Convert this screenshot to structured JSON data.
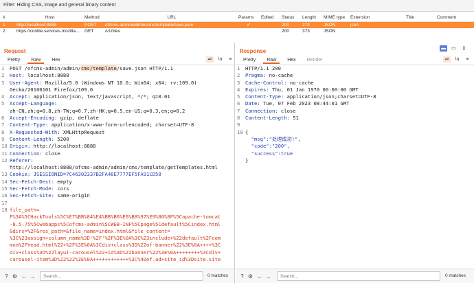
{
  "filter": {
    "text": "Filter: Hiding CSS, image and general binary content"
  },
  "table": {
    "headers": {
      "num": "#",
      "host": "Host",
      "method": "Method",
      "url": "URL",
      "params": "Params",
      "edited": "Edited",
      "status": "Status",
      "length": "Length",
      "mime": "MIME type",
      "extension": "Extension",
      "title": "Title",
      "comment": "Comment"
    },
    "rows": [
      {
        "num": "1",
        "host": "http://localhost:8888",
        "method": "POST",
        "url": "/ofcms-admin/admin/cms/template/save.json",
        "params": "✔",
        "edited": "",
        "status": "200",
        "length": "273",
        "mime": "JSON",
        "extension": "json",
        "title": "",
        "comment": ""
      },
      {
        "num": "2",
        "host": "https://contile.services.mozilla....",
        "method": "GET",
        "url": "/v1/tiles",
        "params": "",
        "edited": "",
        "status": "200",
        "length": "373",
        "mime": "JSON",
        "extension": "",
        "title": "",
        "comment": ""
      }
    ]
  },
  "request": {
    "title": "Request",
    "tabs": [
      "Pretty",
      "Raw",
      "Hex"
    ],
    "icons": {
      "wrap": "⇌",
      "newline": "\\n",
      "menu": "≡"
    },
    "lines": [
      {
        "n": "1",
        "a": "POST /ofcms-admin/admin/",
        "h": "cms/template",
        "b": "/save.json HTTP/1.1"
      },
      {
        "n": "2",
        "k": "Host:",
        "v": " localhost:8888"
      },
      {
        "n": "3",
        "k": "User-Agent:",
        "v": " Mozilla/5.0 (Windows NT 10.0; Win64; x64; rv:109.0)"
      },
      {
        "n": "",
        "v": "Gecko/20100101 Firefox/109.0"
      },
      {
        "n": "4",
        "k": "Accept:",
        "v": " application/json, text/javascript, */*; q=0.01"
      },
      {
        "n": "5",
        "k": "Accept-Language:",
        "v": ""
      },
      {
        "n": "",
        "v": "zh-CN,zh;q=0.8,zh-TW;q=0.7,zh-HK;q=0.5,en-US;q=0.3,en;q=0.2"
      },
      {
        "n": "6",
        "k": "Accept-Encoding:",
        "v": " gzip, deflate"
      },
      {
        "n": "7",
        "k": "Content-Type:",
        "v": " application/x-www-form-urlencoded; charset=UTF-8"
      },
      {
        "n": "8",
        "k": "X-Requested-With:",
        "v": " XMLHttpRequest"
      },
      {
        "n": "9",
        "k": "Content-Length:",
        "v": " 5200"
      },
      {
        "n": "10",
        "k": "Origin:",
        "v": " http://localhost:8888"
      },
      {
        "n": "11",
        "k": "Connection:",
        "v": " close"
      },
      {
        "n": "12",
        "k": "Referer:",
        "v": ""
      },
      {
        "n": "",
        "v": "http://localhost:8888/ofcms-admin/admin/cms/template/getTemplates.html"
      },
      {
        "n": "13",
        "k": "Cookie:",
        "v": " JSESSIONID=",
        "c": "7C46302337B2FA48E7777EF5FA91CD58"
      },
      {
        "n": "14",
        "k": "Sec-Fetch-Dest:",
        "v": " empty"
      },
      {
        "n": "15",
        "k": "Sec-Fetch-Mode:",
        "v": " cors"
      },
      {
        "n": "16",
        "k": "Sec-Fetch-Site:",
        "v": " same-origin"
      },
      {
        "n": "17",
        "v": ""
      },
      {
        "n": "18",
        "r": "file_path="
      },
      {
        "n": "",
        "r": "F%3A%5CHackTools%5C%E7%BB%84%E4%BB%B6%E6%B8%97%E9%80%8F%5Capache-tomcat"
      },
      {
        "n": "",
        "r": "-8.5.75%5Cwebapps%5Cofcms-admin%5CWEB-INF%5Cpage%5Cdefault%5Cindex.html"
      },
      {
        "n": "",
        "r": "&dirs=%2F&res_path=&file_name=index.html&file_content="
      },
      {
        "n": "",
        "r": "%3C%23assign+column_name%3D'%2F'%2F%3E%0A%3C%23include+%22default%2Fcom"
      },
      {
        "n": "",
        "r": "mon%2Fhead.html%22+%2F%3E%0A%3Cdiv+class%3D%22of-banner%22%3E%0A++++%3C"
      },
      {
        "n": "",
        "r": "div+class%3D%22layui-carousel%22+id%3D%22banner%22%3E%0A++++++++%3Cdiv+"
      },
      {
        "n": "",
        "r": "carousel-item%3D%22%22%3E%0A++++++++++++%3C%40of.ad+site_id%3Dsite.site"
      }
    ],
    "search_placeholder": "Search...",
    "matches": "0 matches"
  },
  "response": {
    "title": "Response",
    "tabs": [
      "Pretty",
      "Raw",
      "Hex",
      "Render"
    ],
    "icons": {
      "wrap": "⇌",
      "newline": "\\n",
      "menu": "≡"
    },
    "lines": [
      {
        "n": "1",
        "a": "HTTP/1.1 200"
      },
      {
        "n": "2",
        "k": "Pragma:",
        "v": " no-cache"
      },
      {
        "n": "3",
        "k": "Cache-Control:",
        "v": " no-cache"
      },
      {
        "n": "4",
        "k": "Expires:",
        "v": " Thu, 01 Jan 1970 00:00:00 GMT"
      },
      {
        "n": "5",
        "k": "Content-Type:",
        "v": " application/json;charset=UTF-8"
      },
      {
        "n": "6",
        "k": "Date:",
        "v": " Tue, 07 Feb 2023 08:44:01 GMT"
      },
      {
        "n": "7",
        "k": "Connection:",
        "v": " close"
      },
      {
        "n": "8",
        "k": "Content-Length:",
        "v": " 51"
      },
      {
        "n": "9",
        "v": ""
      },
      {
        "n": "10",
        "a": "{"
      },
      {
        "n": "",
        "j": "  \"msg\":\"处理成功!\","
      },
      {
        "n": "",
        "j": "  \"code\":\"200\","
      },
      {
        "n": "",
        "j": "  \"success\":true"
      },
      {
        "n": "",
        "a": "}"
      }
    ],
    "search_placeholder": "Search...",
    "matches": "0 matches"
  },
  "colors": {
    "accent": "#e4631e",
    "selected_row": "#ff8a33",
    "header_key": "#1d3c9c",
    "body_param": "#d03a18"
  }
}
